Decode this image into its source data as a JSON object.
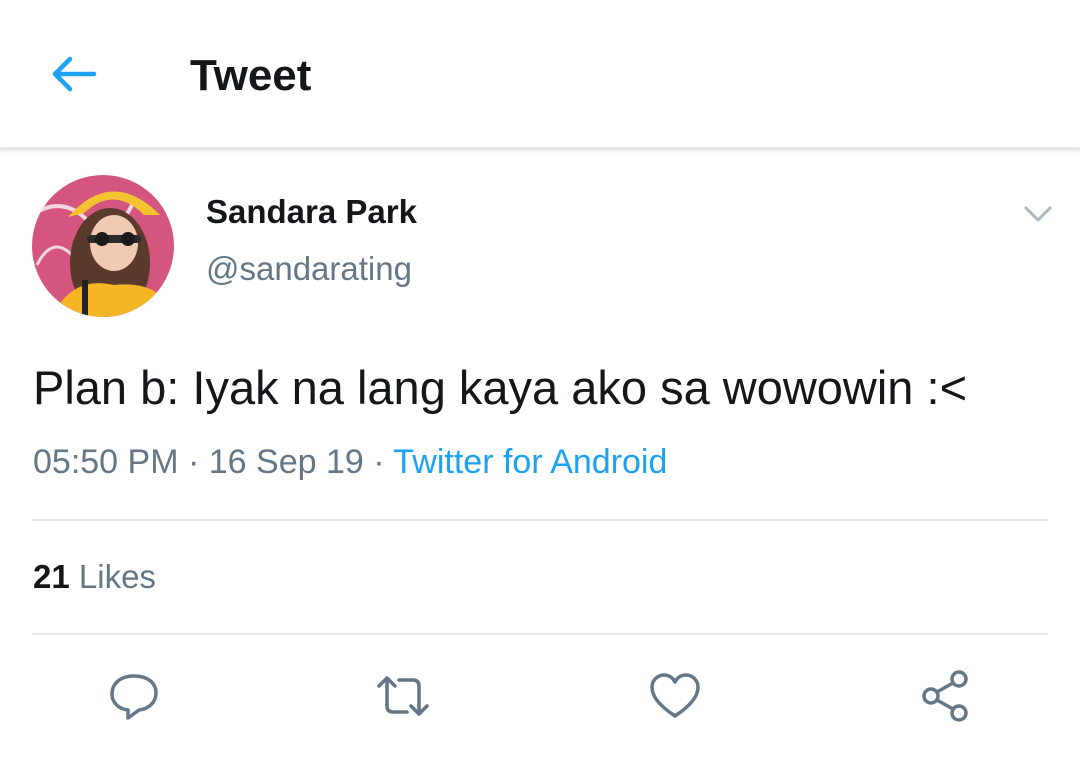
{
  "header": {
    "title": "Tweet",
    "back_icon": "arrow-left-icon"
  },
  "tweet": {
    "author": {
      "name": "Sandara Park",
      "handle": "@sandarating"
    },
    "text": "Plan b: Iyak na lang kaya ako sa wowowin :<",
    "time": "05:50 PM",
    "date": "16 Sep 19",
    "separator": " · ",
    "source": "Twitter for Android",
    "likes_count": "21",
    "likes_label": "Likes"
  },
  "actions": {
    "reply": "reply-icon",
    "retweet": "retweet-icon",
    "like": "heart-icon",
    "share": "share-icon"
  },
  "colors": {
    "accent": "#1da1f2",
    "text": "#14171a",
    "secondary": "#657786",
    "border": "#e1e8ed"
  }
}
